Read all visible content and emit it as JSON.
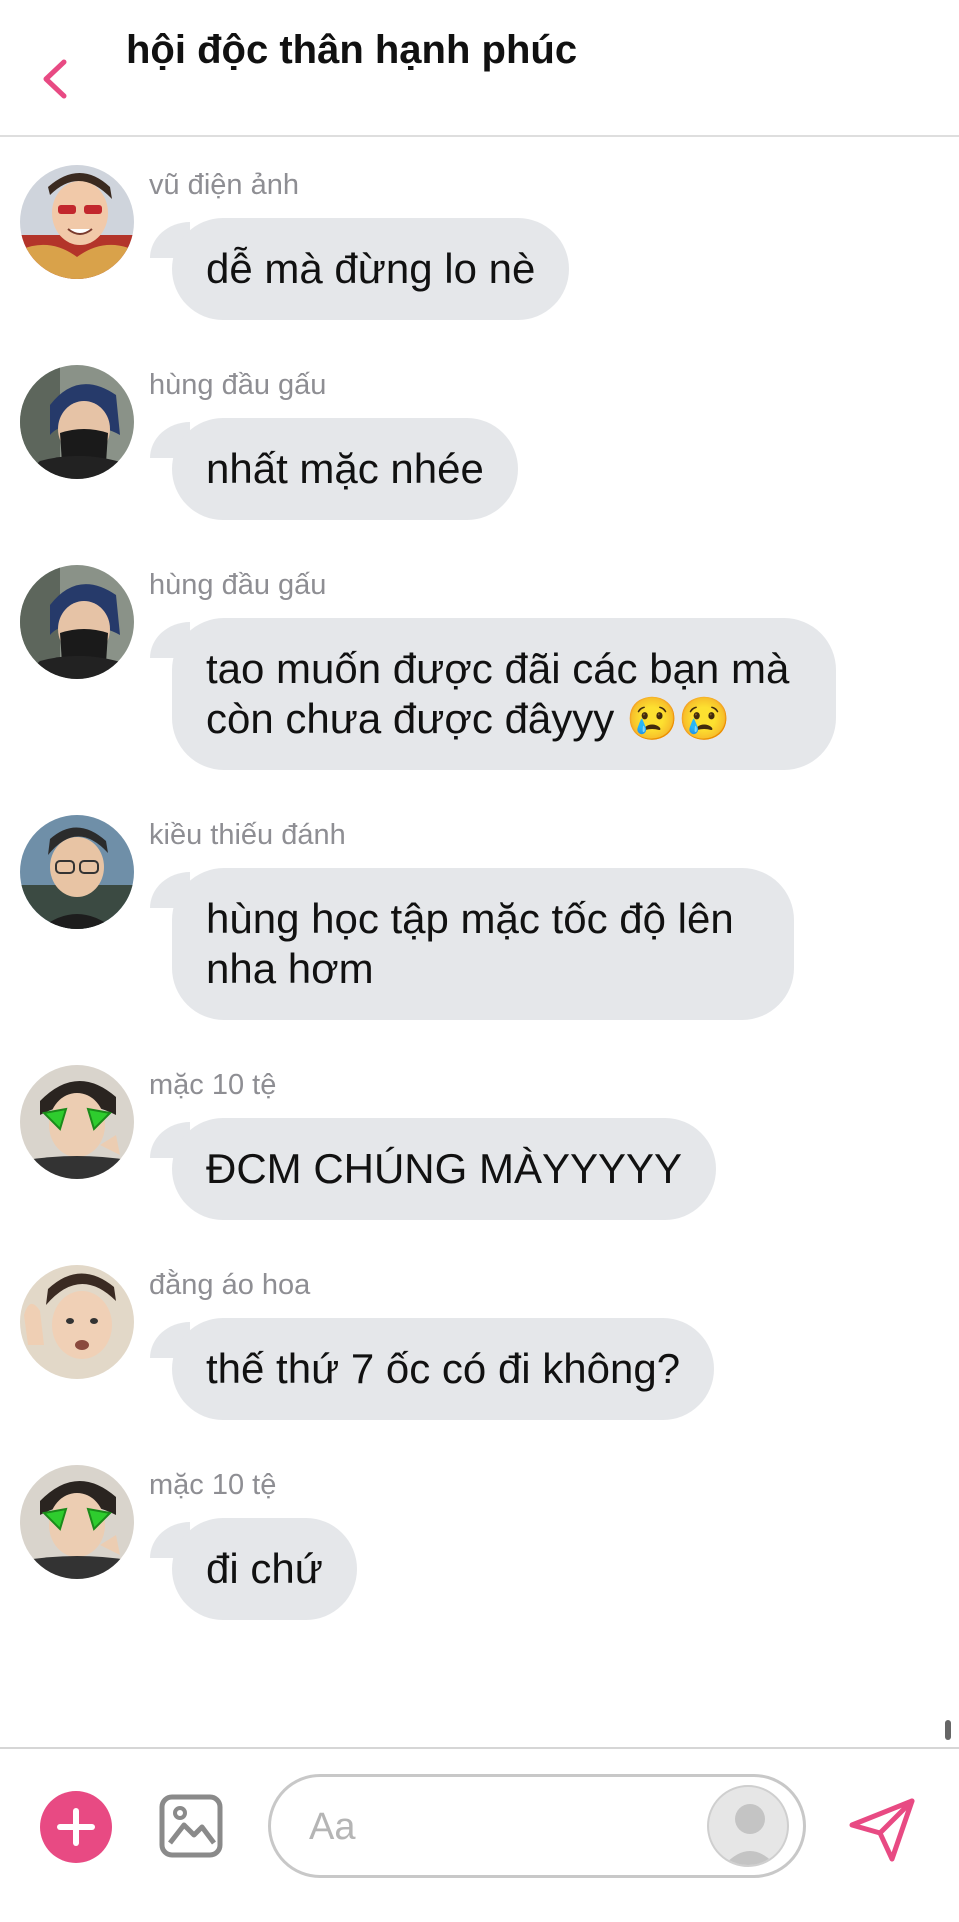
{
  "header": {
    "title": "hội độc thân hạnh phúc"
  },
  "messages": [
    {
      "sender": "vũ điện ảnh",
      "text": "dễ mà đừng lo nè"
    },
    {
      "sender": "hùng đầu gấu",
      "text": "nhất mặc nhée"
    },
    {
      "sender": "hùng đầu gấu",
      "text": "tao muốn được đãi các bạn mà còn chưa được đâyyy 😢😢"
    },
    {
      "sender": "kiều thiếu đánh",
      "text": "hùng học tập mặc tốc độ lên nha hơm"
    },
    {
      "sender": "mặc 10 tệ",
      "text": "ĐCM CHÚNG MÀYYYYY"
    },
    {
      "sender": "đằng áo hoa",
      "text": "thế thứ 7 ốc có đi không?"
    },
    {
      "sender": "mặc 10 tệ",
      "text": "đi chứ"
    }
  ],
  "composer": {
    "placeholder": "Aa"
  },
  "colors": {
    "accent": "#e84a83",
    "bubble": "#e5e7ea",
    "sender": "#8e8e93"
  },
  "icons": {
    "back": "chevron-left-icon",
    "add": "plus-icon",
    "image": "image-icon",
    "profile": "profile-placeholder-icon",
    "send": "send-icon"
  }
}
